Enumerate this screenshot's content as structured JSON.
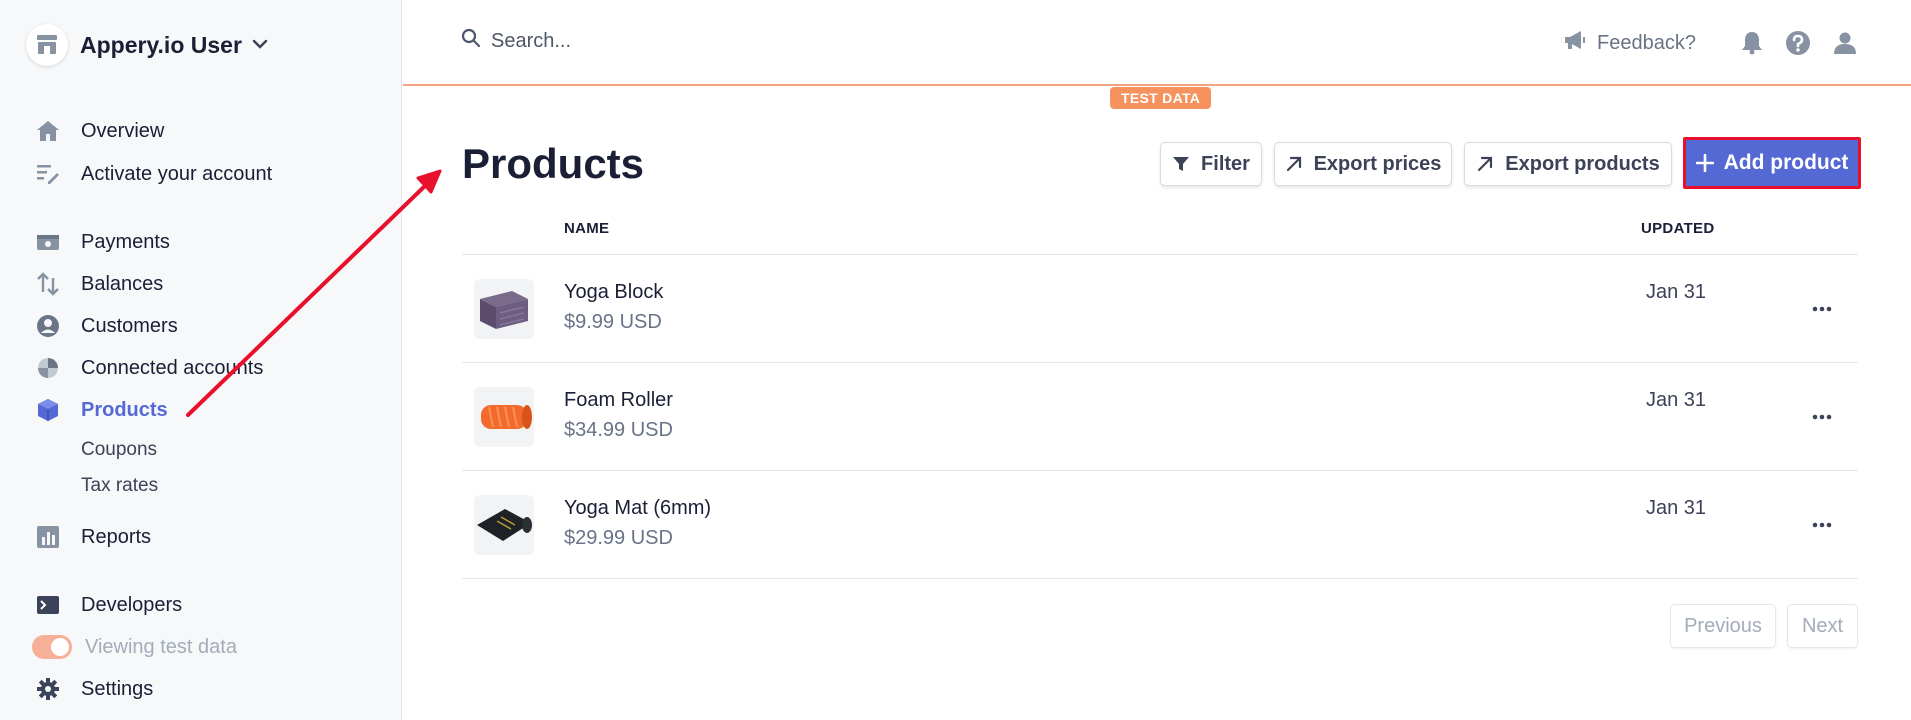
{
  "account": {
    "name": "Appery.io User"
  },
  "sidebar": {
    "items": [
      {
        "label": "Overview"
      },
      {
        "label": "Activate your account"
      },
      {
        "label": "Payments"
      },
      {
        "label": "Balances"
      },
      {
        "label": "Customers"
      },
      {
        "label": "Connected accounts"
      },
      {
        "label": "Products"
      },
      {
        "label": "Reports"
      },
      {
        "label": "Developers"
      },
      {
        "label": "Viewing test data"
      },
      {
        "label": "Settings"
      }
    ],
    "sub_items": [
      {
        "label": "Coupons"
      },
      {
        "label": "Tax rates"
      }
    ],
    "active": "Products"
  },
  "header": {
    "search_placeholder": "Search...",
    "feedback_label": "Feedback?",
    "test_badge": "TEST DATA"
  },
  "main": {
    "title": "Products",
    "buttons": {
      "filter": "Filter",
      "export_prices": "Export prices",
      "export_products": "Export products",
      "add_product": "Add product"
    },
    "columns": {
      "name": "NAME",
      "updated": "UPDATED"
    },
    "rows": [
      {
        "name": "Yoga Block",
        "price": "$9.99 USD",
        "updated": "Jan 31",
        "thumb_icon": "yoga-block-icon"
      },
      {
        "name": "Foam Roller",
        "price": "$34.99 USD",
        "updated": "Jan 31",
        "thumb_icon": "foam-roller-icon"
      },
      {
        "name": "Yoga Mat (6mm)",
        "price": "$29.99 USD",
        "updated": "Jan 31",
        "thumb_icon": "yoga-mat-icon"
      }
    ],
    "pagination": {
      "previous": "Previous",
      "next": "Next"
    }
  },
  "colors": {
    "accent": "#5469d4",
    "test_data": "#f5925e",
    "highlight_border": "#e8102a",
    "annotation_arrow": "#e8102a"
  }
}
